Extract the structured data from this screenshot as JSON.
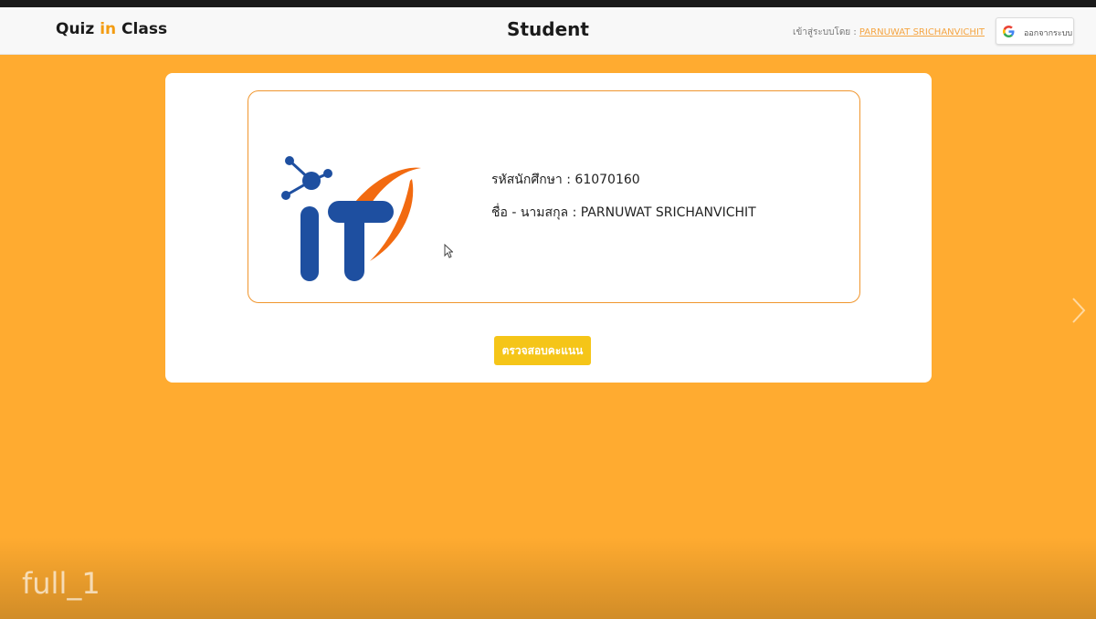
{
  "header": {
    "brand": {
      "part1": "Quiz ",
      "part2": "in",
      "part3": " Class"
    },
    "page_title": "Student",
    "login_label": "เข้าสู่ระบบโดย : ",
    "login_user": "PARNUWAT SRICHANVICHIT",
    "logout_label": "ออกจากระบบ",
    "logout_icon": "google-icon"
  },
  "student": {
    "id_label": "รหัสนักศึกษา : ",
    "id_value": "61070160",
    "name_label": "ชื่อ - นามสกุล : ",
    "name_value": "PARNUWAT SRICHANVICHIT",
    "logo_text": "IT"
  },
  "actions": {
    "check_score": "ตรวจสอบคะแนน"
  },
  "watermark": "full_1",
  "colors": {
    "background": "#ffab30",
    "accent": "#f39c12",
    "button": "#f5c518",
    "logo_blue": "#1e4fa0",
    "logo_orange": "#f26a10"
  }
}
